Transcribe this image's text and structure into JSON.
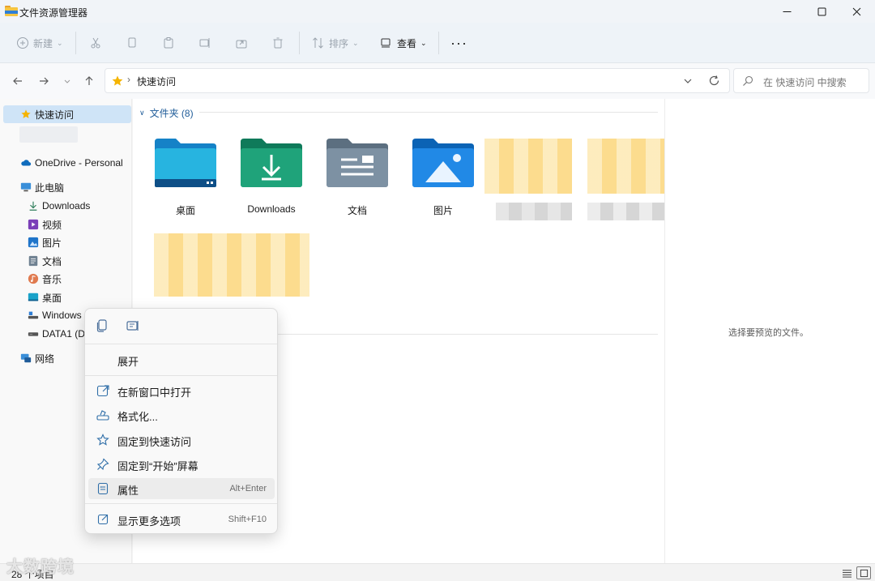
{
  "window": {
    "title": "文件资源管理器"
  },
  "toolbar": {
    "new_label": "新建",
    "sort_label": "排序",
    "view_label": "查看"
  },
  "address": {
    "location": "快速访问",
    "search_placeholder": "在 快速访问 中搜索"
  },
  "sidebar": {
    "quick_access": "快速访问",
    "onedrive": "OneDrive - Personal",
    "this_pc": "此电脑",
    "items": [
      {
        "label": "Downloads",
        "icon": "download-icon"
      },
      {
        "label": "视频",
        "icon": "video-icon"
      },
      {
        "label": "图片",
        "icon": "pictures-icon"
      },
      {
        "label": "文档",
        "icon": "documents-icon"
      },
      {
        "label": "音乐",
        "icon": "music-icon"
      },
      {
        "label": "桌面",
        "icon": "desktop-icon"
      },
      {
        "label": "Windows",
        "icon": "drive-icon"
      },
      {
        "label": "DATA1 (D",
        "icon": "drive-icon"
      }
    ],
    "network": "网络"
  },
  "content": {
    "group_title": "文件夹 (8)",
    "folders": [
      {
        "label": "桌面",
        "icon": "desktop-folder-icon"
      },
      {
        "label": "Downloads",
        "icon": "downloads-folder-icon"
      },
      {
        "label": "文档",
        "icon": "documents-folder-icon"
      },
      {
        "label": "图片",
        "icon": "pictures-folder-icon"
      }
    ]
  },
  "preview": {
    "empty_text": "选择要预览的文件。"
  },
  "context_menu": {
    "expand": "展开",
    "open_new_window": "在新窗口中打开",
    "format": "格式化...",
    "pin_quick_access": "固定到快速访问",
    "pin_start": "固定到“开始”屏幕",
    "properties": "属性",
    "properties_shortcut": "Alt+Enter",
    "more_options": "显示更多选项",
    "more_options_shortcut": "Shift+F10"
  },
  "status": {
    "item_count": "28 个项目"
  },
  "watermark": "大数跨境",
  "colors": {
    "accent": "#1f5c99",
    "selection": "#cfe4f7",
    "folder_yellow": "#f5c542"
  }
}
